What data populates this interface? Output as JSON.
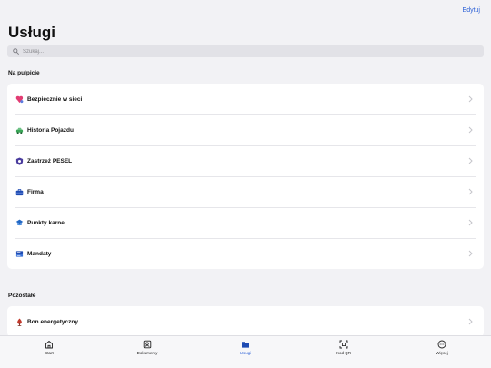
{
  "header": {
    "edit_label": "Edytuj",
    "title": "Usługi"
  },
  "search": {
    "placeholder": "Szukaj..."
  },
  "sections": {
    "desktop": {
      "heading": "Na pulpicie",
      "items": [
        {
          "label": "Bezpiecznie w sieci",
          "icon": "heart-shield-icon"
        },
        {
          "label": "Historia Pojazdu",
          "icon": "car-icon"
        },
        {
          "label": "Zastrzeż PESEL",
          "icon": "shield-icon"
        },
        {
          "label": "Firma",
          "icon": "briefcase-icon"
        },
        {
          "label": "Punkty karne",
          "icon": "badge-icon"
        },
        {
          "label": "Mandaty",
          "icon": "tickets-icon"
        }
      ]
    },
    "other": {
      "heading": "Pozostałe",
      "items": [
        {
          "label": "Bon energetyczny",
          "icon": "energy-icon"
        }
      ]
    }
  },
  "tabs": [
    {
      "label": "Start",
      "icon": "home-icon",
      "active": false
    },
    {
      "label": "Dokumenty",
      "icon": "id-card-icon",
      "active": false
    },
    {
      "label": "Usługi",
      "icon": "folder-icon",
      "active": true
    },
    {
      "label": "Kod QR",
      "icon": "qr-scan-icon",
      "active": false
    },
    {
      "label": "Więcej",
      "icon": "more-icon",
      "active": false
    }
  ],
  "colors": {
    "accent": "#2a5fd6",
    "background": "#f2f2f5",
    "card": "#ffffff",
    "search_bg": "#e2e2e7"
  }
}
